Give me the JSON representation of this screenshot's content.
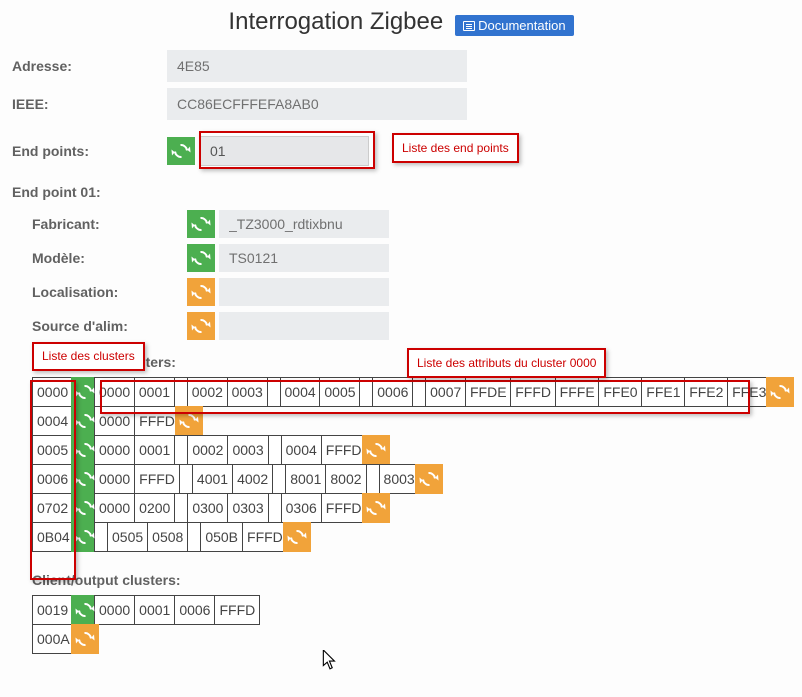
{
  "title": "Interrogation Zigbee",
  "doc_label": "Documentation",
  "labels": {
    "addr": "Adresse:",
    "ieee": "IEEE:",
    "endpoints": "End points:",
    "ep_section": "End point 01:",
    "fabricant": "Fabricant:",
    "modele": "Modèle:",
    "localisation": "Localisation:",
    "source": "Source d'alim:",
    "server_clusters": "Server/input clusters:",
    "client_clusters": "Client/output clusters:"
  },
  "values": {
    "addr": "4E85",
    "ieee": "CC86ECFFFEFA8AB0",
    "endpoint": "01",
    "fabricant": "_TZ3000_rdtixbnu",
    "modele": "TS0121",
    "localisation": "",
    "source": ""
  },
  "callouts": {
    "clusters": "Liste des clusters",
    "endpoints": "Liste des end points",
    "attrs": "Liste des attributs du cluster 0000"
  },
  "server_clusters": [
    {
      "id": "0000",
      "btn": "green",
      "attrs": [
        "0000",
        "0001",
        "",
        "0002",
        "0003",
        "",
        "0004",
        "0005",
        "",
        "0006",
        "",
        "0007",
        "FFDE",
        "FFFD",
        "FFFE",
        "FFE0",
        "FFE1",
        "FFE2",
        "FFE3"
      ],
      "trail_btn": "orange"
    },
    {
      "id": "0004",
      "btn": "green",
      "attrs": [
        "0000",
        "FFFD"
      ],
      "trail_btn": "orange"
    },
    {
      "id": "0005",
      "btn": "green",
      "attrs": [
        "0000",
        "0001",
        "",
        "0002",
        "0003",
        "",
        "0004",
        "FFFD"
      ],
      "trail_btn": "orange"
    },
    {
      "id": "0006",
      "btn": "green",
      "attrs": [
        "0000",
        "FFFD",
        "",
        "4001",
        "4002",
        "",
        "8001",
        "8002",
        "",
        "8003"
      ],
      "trail_btn": "orange"
    },
    {
      "id": "0702",
      "btn": "green",
      "attrs": [
        "0000",
        "0200",
        "",
        "0300",
        "0303",
        "",
        "0306",
        "FFFD"
      ],
      "trail_btn": "orange"
    },
    {
      "id": "0B04",
      "btn": "green",
      "attrs": [
        "",
        "0505",
        "0508",
        "",
        "050B",
        "FFFD"
      ],
      "trail_btn": "orange"
    }
  ],
  "client_clusters": [
    {
      "id": "0019",
      "btn": "green",
      "attrs": [
        "0000",
        "0001",
        "0006",
        "FFFD"
      ],
      "trail_btn": null
    },
    {
      "id": "000A",
      "btn": "orange",
      "attrs": [],
      "trail_btn": null
    }
  ]
}
